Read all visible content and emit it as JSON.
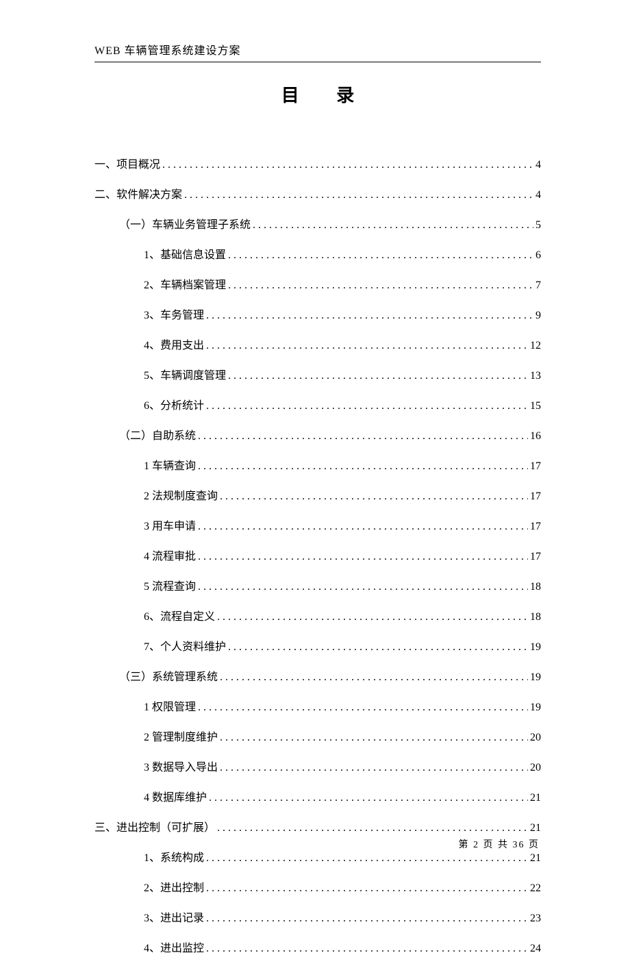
{
  "header": {
    "title": "WEB 车辆管理系统建设方案"
  },
  "title": "目 录",
  "toc": [
    {
      "label": "一、项目概况",
      "page": "4",
      "indent": 0
    },
    {
      "label": "二、软件解决方案",
      "page": "4",
      "indent": 0
    },
    {
      "label": "（一）车辆业务管理子系统",
      "page": "5",
      "indent": 1
    },
    {
      "label": "1、基础信息设置",
      "page": "6",
      "indent": 2
    },
    {
      "label": "2、车辆档案管理",
      "page": "7",
      "indent": 2
    },
    {
      "label": "3、车务管理",
      "page": "9",
      "indent": 2
    },
    {
      "label": "4、费用支出",
      "page": "12",
      "indent": 2
    },
    {
      "label": "5、车辆调度管理",
      "page": "13",
      "indent": 2
    },
    {
      "label": "6、分析统计",
      "page": "15",
      "indent": 2
    },
    {
      "label": "（二）自助系统",
      "page": "16",
      "indent": 1
    },
    {
      "label": "1 车辆查询",
      "page": "17",
      "indent": 2
    },
    {
      "label": "2 法规制度查询",
      "page": "17",
      "indent": 2
    },
    {
      "label": "3 用车申请",
      "page": "17",
      "indent": 2
    },
    {
      "label": "4 流程审批",
      "page": "17",
      "indent": 2
    },
    {
      "label": "5 流程查询",
      "page": "18",
      "indent": 2
    },
    {
      "label": "6、流程自定义",
      "page": "18",
      "indent": 2
    },
    {
      "label": "7、个人资料维护",
      "page": "19",
      "indent": 2
    },
    {
      "label": "（三）系统管理系统",
      "page": "19",
      "indent": 1
    },
    {
      "label": "1 权限管理",
      "page": "19",
      "indent": 2
    },
    {
      "label": "2 管理制度维护",
      "page": "20",
      "indent": 2
    },
    {
      "label": "3 数据导入导出",
      "page": "20",
      "indent": 2
    },
    {
      "label": "4 数据库维护",
      "page": "21",
      "indent": 2
    },
    {
      "label": "三、进出控制（可扩展）",
      "page": "21",
      "indent": 0
    },
    {
      "label": "1、系统构成",
      "page": "21",
      "indent": 2
    },
    {
      "label": "2、进出控制",
      "page": "22",
      "indent": 2
    },
    {
      "label": "3、进出记录",
      "page": "23",
      "indent": 2
    },
    {
      "label": "4、进出监控",
      "page": "24",
      "indent": 2
    }
  ],
  "footer": {
    "text": "第 2 页 共 36 页"
  }
}
